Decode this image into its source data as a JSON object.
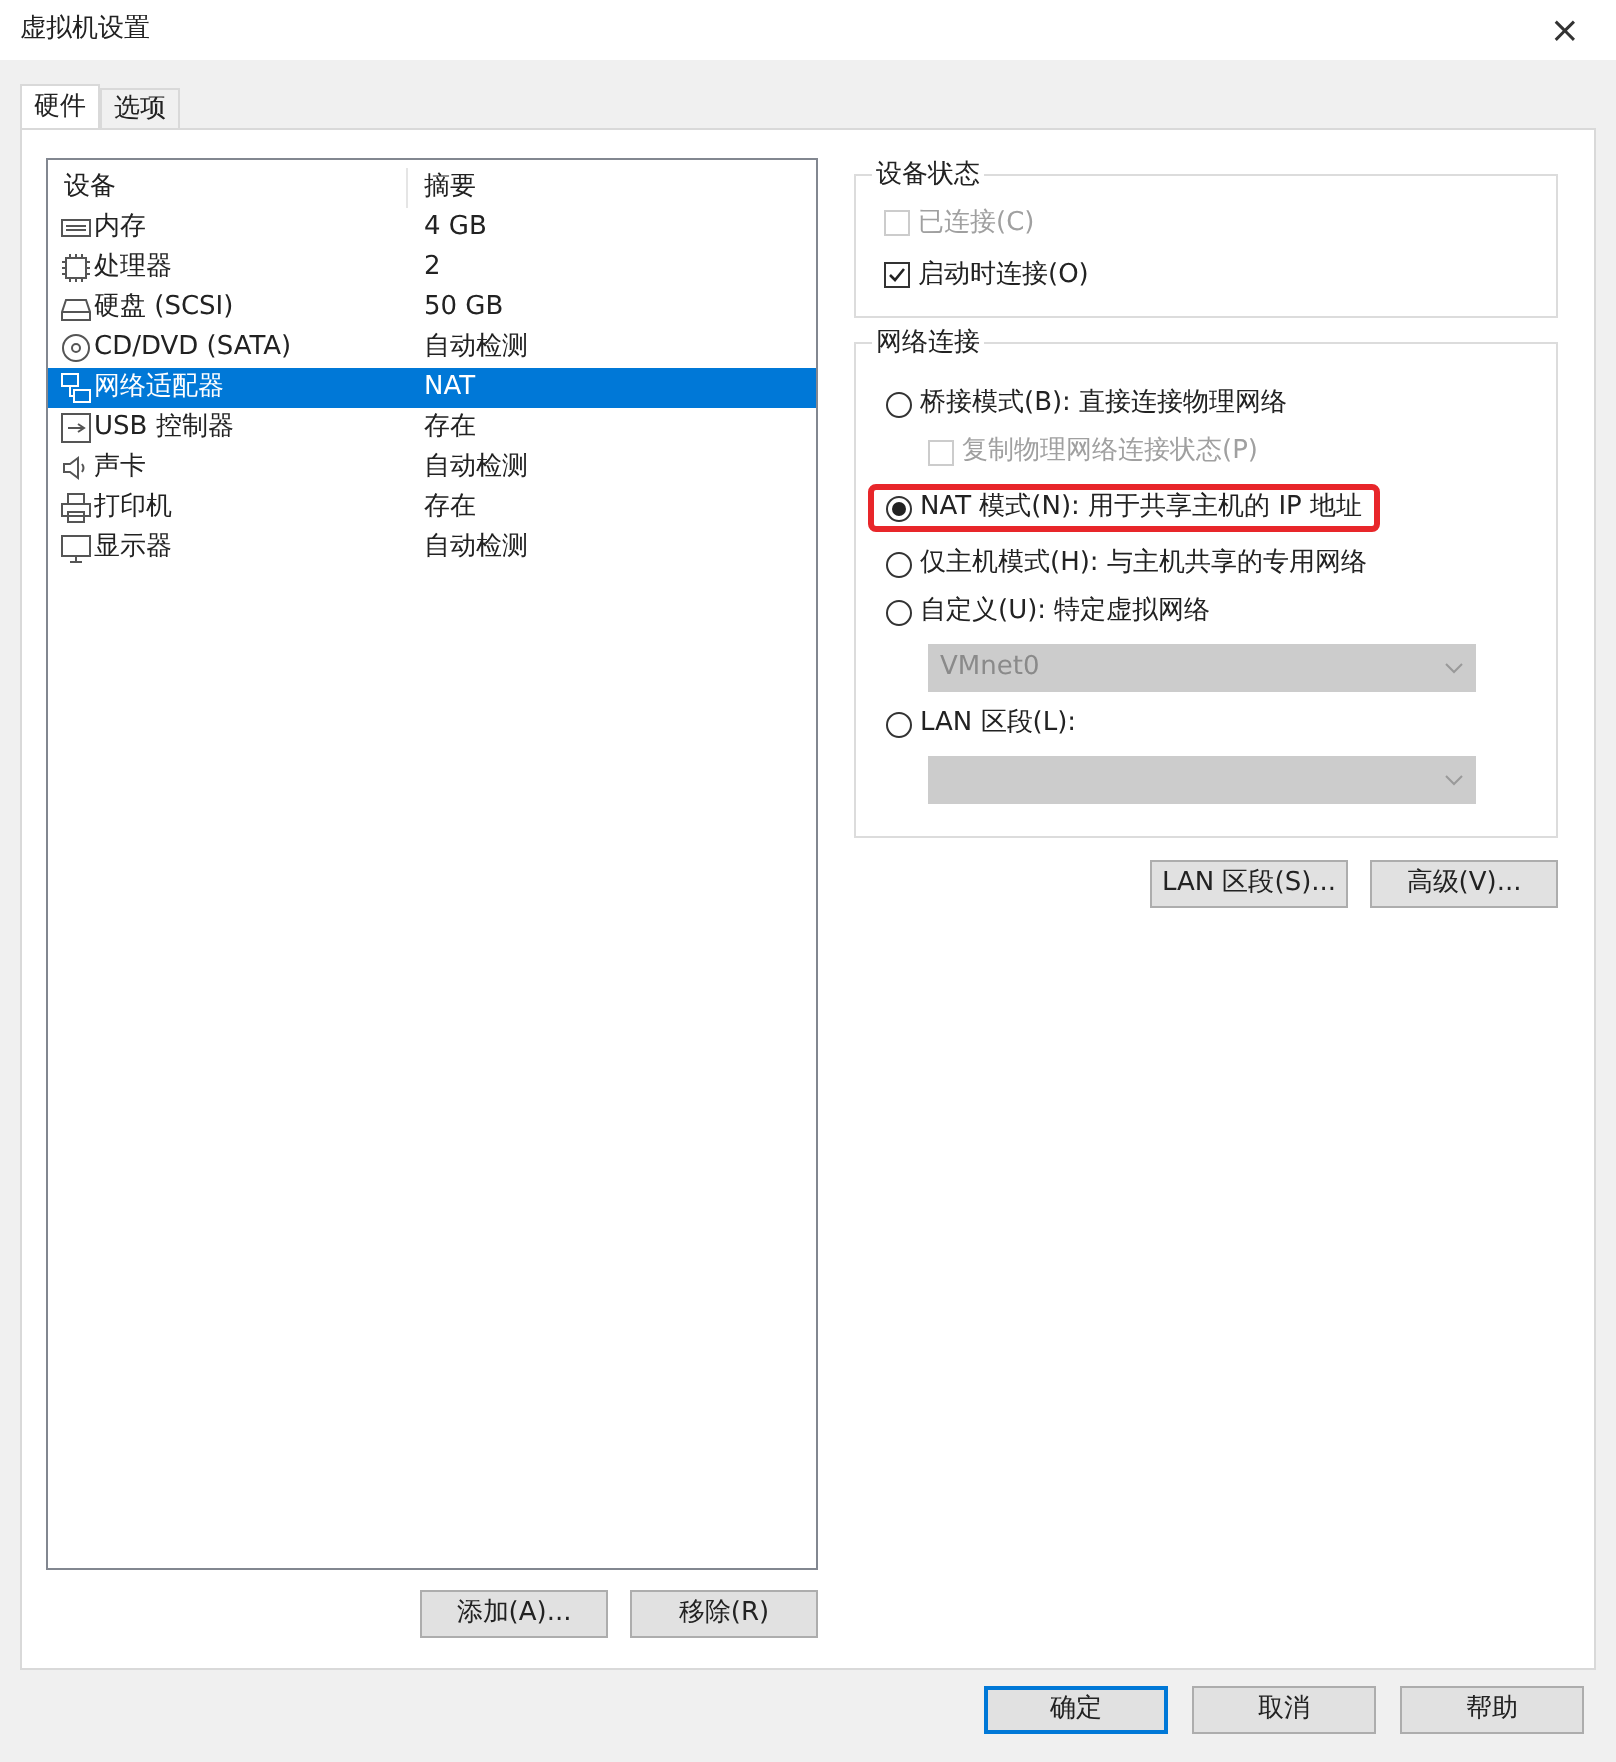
{
  "window": {
    "title": "虚拟机设置",
    "close": "×"
  },
  "tabs": [
    {
      "label": "硬件",
      "selected": true
    },
    {
      "label": "选项",
      "selected": false
    }
  ],
  "device_table": {
    "columns": [
      "设备",
      "摘要"
    ],
    "rows": [
      {
        "kind": "memory",
        "device": "内存",
        "summary": "4 GB",
        "selected": false
      },
      {
        "kind": "cpu",
        "device": "处理器",
        "summary": "2",
        "selected": false
      },
      {
        "kind": "disk",
        "device": "硬盘 (SCSI)",
        "summary": "50 GB",
        "selected": false
      },
      {
        "kind": "cd",
        "device": "CD/DVD (SATA)",
        "summary": "自动检测",
        "selected": false
      },
      {
        "kind": "network",
        "device": "网络适配器",
        "summary": "NAT",
        "selected": true
      },
      {
        "kind": "usb",
        "device": "USB 控制器",
        "summary": "存在",
        "selected": false
      },
      {
        "kind": "sound",
        "device": "声卡",
        "summary": "自动检测",
        "selected": false
      },
      {
        "kind": "printer",
        "device": "打印机",
        "summary": "存在",
        "selected": false
      },
      {
        "kind": "display",
        "device": "显示器",
        "summary": "自动检测",
        "selected": false
      }
    ]
  },
  "device_buttons": [
    "添加(A)...",
    "移除(R)"
  ],
  "device_status": {
    "title": "设备状态",
    "options": [
      {
        "label": "已连接(C)",
        "checked": false,
        "disabled": true
      },
      {
        "label": "启动时连接(O)",
        "checked": true,
        "disabled": false
      }
    ]
  },
  "network_connection": {
    "title": "网络连接",
    "options": [
      {
        "kind": "radio",
        "label": "桥接模式(B): 直接连接物理网络",
        "selected": false,
        "highlighted": false
      },
      {
        "kind": "checkbox",
        "label": "复制物理网络连接状态(P)",
        "checked": false,
        "disabled": true
      },
      {
        "kind": "radio",
        "label": "NAT 模式(N): 用于共享主机的 IP 地址",
        "selected": true,
        "highlighted": true
      },
      {
        "kind": "radio",
        "label": "仅主机模式(H): 与主机共享的专用网络",
        "selected": false,
        "highlighted": false
      },
      {
        "kind": "radio",
        "label": "自定义(U): 特定虚拟网络",
        "selected": false,
        "highlighted": false
      },
      {
        "kind": "dropdown",
        "value": "VMnet0",
        "disabled": true
      },
      {
        "kind": "radio",
        "label": "LAN 区段(L):",
        "selected": false,
        "highlighted": false
      },
      {
        "kind": "dropdown",
        "disabled": true
      }
    ]
  },
  "network_buttons": [
    "LAN 区段(S)...",
    "高级(V)..."
  ],
  "dialog_buttons": [
    {
      "label": "确定",
      "default": true
    },
    {
      "label": "取消",
      "default": false
    },
    {
      "label": "帮助",
      "default": false
    }
  ]
}
